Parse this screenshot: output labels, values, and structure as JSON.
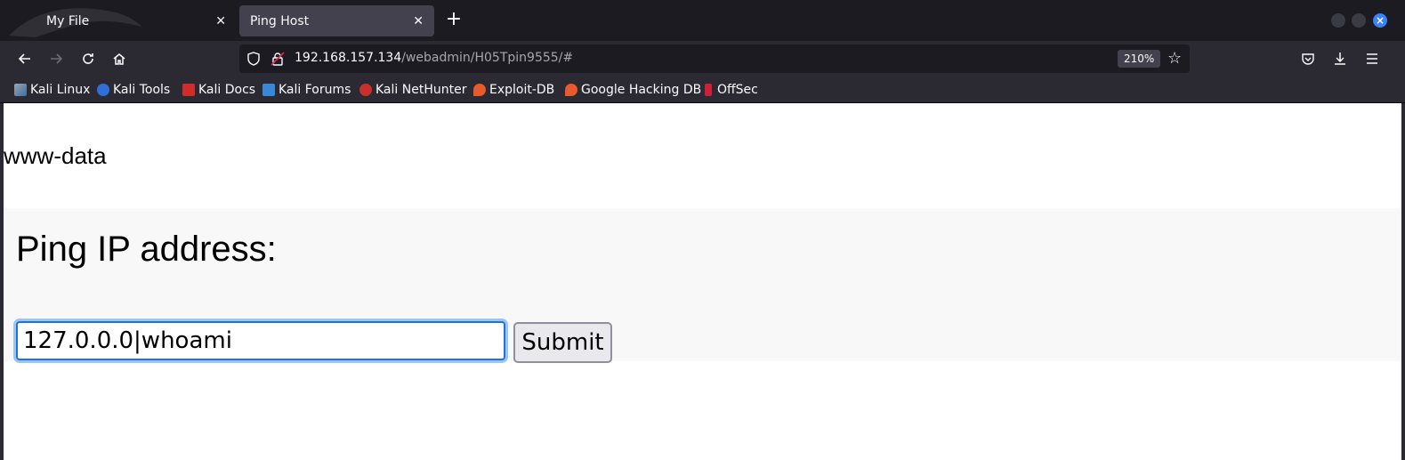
{
  "browser": {
    "tabs": [
      {
        "title": "My File",
        "close": "✕"
      },
      {
        "title": "Ping Host",
        "close": "✕"
      }
    ],
    "new_tab": "+",
    "url": {
      "host": "192.168.157.134",
      "path": "/webadmin/H05Tpin9555/#"
    },
    "zoom": "210%",
    "bookmarks": [
      {
        "label": "Kali Linux"
      },
      {
        "label": "Kali Tools"
      },
      {
        "label": "Kali Docs"
      },
      {
        "label": "Kali Forums"
      },
      {
        "label": "Kali NetHunter"
      },
      {
        "label": "Exploit-DB"
      },
      {
        "label": "Google Hacking DB"
      },
      {
        "label": "OffSec"
      }
    ]
  },
  "page": {
    "output": "www-data",
    "form": {
      "title": "Ping IP address:",
      "input_value": "127.0.0.0|whoami",
      "submit_label": "Submit"
    }
  },
  "colors": {
    "accent": "#1a73e8",
    "chrome_dark": "#1c1b22",
    "chrome": "#2b2a33"
  }
}
